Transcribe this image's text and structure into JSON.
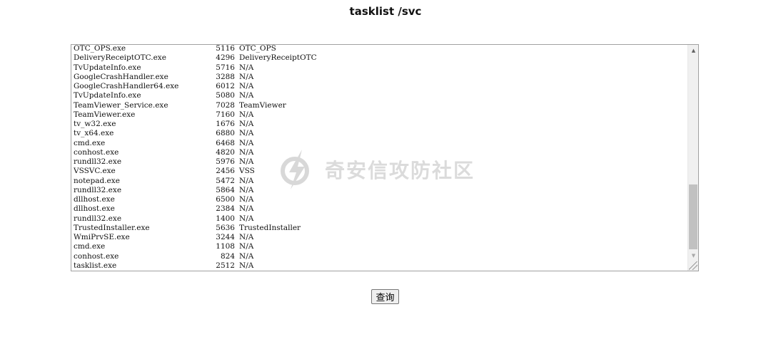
{
  "page": {
    "title": "tasklist /svc"
  },
  "output": {
    "rows": [
      {
        "name": "OTC_OPS.exe",
        "pid": "5116",
        "services": "OTC_OPS"
      },
      {
        "name": "DeliveryReceiptOTC.exe",
        "pid": "4296",
        "services": "DeliveryReceiptOTC"
      },
      {
        "name": "TvUpdateInfo.exe",
        "pid": "5716",
        "services": "N/A"
      },
      {
        "name": "GoogleCrashHandler.exe",
        "pid": "3288",
        "services": "N/A"
      },
      {
        "name": "GoogleCrashHandler64.exe",
        "pid": "6012",
        "services": "N/A"
      },
      {
        "name": "TvUpdateInfo.exe",
        "pid": "5080",
        "services": "N/A"
      },
      {
        "name": "TeamViewer_Service.exe",
        "pid": "7028",
        "services": "TeamViewer"
      },
      {
        "name": "TeamViewer.exe",
        "pid": "7160",
        "services": "N/A"
      },
      {
        "name": "tv_w32.exe",
        "pid": "1676",
        "services": "N/A"
      },
      {
        "name": "tv_x64.exe",
        "pid": "6880",
        "services": "N/A"
      },
      {
        "name": "cmd.exe",
        "pid": "6468",
        "services": "N/A"
      },
      {
        "name": "conhost.exe",
        "pid": "4820",
        "services": "N/A"
      },
      {
        "name": "rundll32.exe",
        "pid": "5976",
        "services": "N/A"
      },
      {
        "name": "VSSVC.exe",
        "pid": "2456",
        "services": "VSS"
      },
      {
        "name": "notepad.exe",
        "pid": "5472",
        "services": "N/A"
      },
      {
        "name": "rundll32.exe",
        "pid": "5864",
        "services": "N/A"
      },
      {
        "name": "dllhost.exe",
        "pid": "6500",
        "services": "N/A"
      },
      {
        "name": "dllhost.exe",
        "pid": "2384",
        "services": "N/A"
      },
      {
        "name": "rundll32.exe",
        "pid": "1400",
        "services": "N/A"
      },
      {
        "name": "TrustedInstaller.exe",
        "pid": "5636",
        "services": "TrustedInstaller"
      },
      {
        "name": "WmiPrvSE.exe",
        "pid": "3244",
        "services": "N/A"
      },
      {
        "name": "cmd.exe",
        "pid": "1108",
        "services": "N/A"
      },
      {
        "name": "conhost.exe",
        "pid": "824",
        "services": "N/A"
      },
      {
        "name": "tasklist.exe",
        "pid": "2512",
        "services": "N/A"
      }
    ]
  },
  "scrollbar": {
    "up_icon": "triangle-up-icon",
    "down_icon": "triangle-down-icon",
    "position": "bottom"
  },
  "watermark": {
    "text": "奇安信攻防社区",
    "icon": "lightning-bolt-logo"
  },
  "query_button": {
    "label": "查询"
  }
}
